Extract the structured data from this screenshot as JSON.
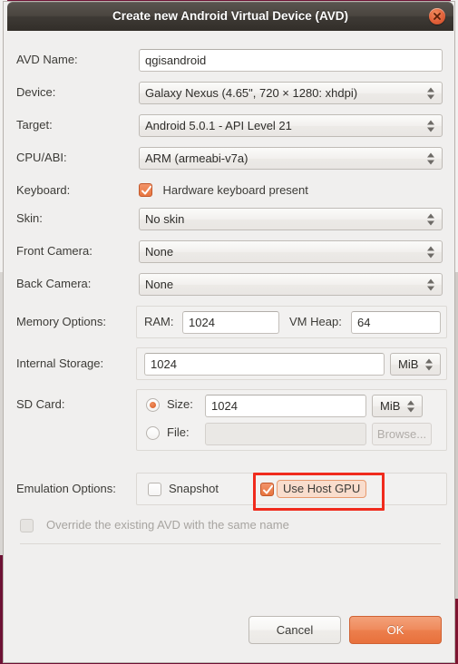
{
  "window": {
    "title": "Create new Android Virtual Device (AVD)",
    "close_icon": "close-icon"
  },
  "fields": {
    "avd_name": {
      "label": "AVD Name:",
      "value": "qgisandroid"
    },
    "device": {
      "label": "Device:",
      "value": "Galaxy Nexus (4.65\", 720 × 1280: xhdpi)"
    },
    "target": {
      "label": "Target:",
      "value": "Android 5.0.1 - API Level 21"
    },
    "cpu_abi": {
      "label": "CPU/ABI:",
      "value": "ARM (armeabi-v7a)"
    },
    "keyboard": {
      "label": "Keyboard:",
      "checkbox_label": "Hardware keyboard present",
      "checked": true
    },
    "skin": {
      "label": "Skin:",
      "value": "No skin"
    },
    "front_camera": {
      "label": "Front Camera:",
      "value": "None"
    },
    "back_camera": {
      "label": "Back Camera:",
      "value": "None"
    },
    "memory_options": {
      "label": "Memory Options:",
      "ram_label": "RAM:",
      "ram_value": "1024",
      "vm_heap_label": "VM Heap:",
      "vm_heap_value": "64"
    },
    "internal_storage": {
      "label": "Internal Storage:",
      "value": "1024",
      "unit": "MiB"
    },
    "sd_card": {
      "label": "SD Card:",
      "size_radio_label": "Size:",
      "size_selected": true,
      "size_value": "1024",
      "size_unit": "MiB",
      "file_radio_label": "File:",
      "file_selected": false,
      "file_value": "",
      "browse_label": "Browse..."
    },
    "emulation_options": {
      "label": "Emulation Options:",
      "snapshot_label": "Snapshot",
      "snapshot_checked": false,
      "use_host_gpu_label": "Use Host GPU",
      "use_host_gpu_checked": true
    },
    "override": {
      "label": "Override the existing AVD with the same name",
      "checked": false,
      "enabled": false
    }
  },
  "buttons": {
    "cancel": "Cancel",
    "ok": "OK"
  },
  "colors": {
    "accent": "#e8713c",
    "annotation": "#f02b1d",
    "titlebar": "#3e3a35",
    "body": "#f0efee"
  }
}
